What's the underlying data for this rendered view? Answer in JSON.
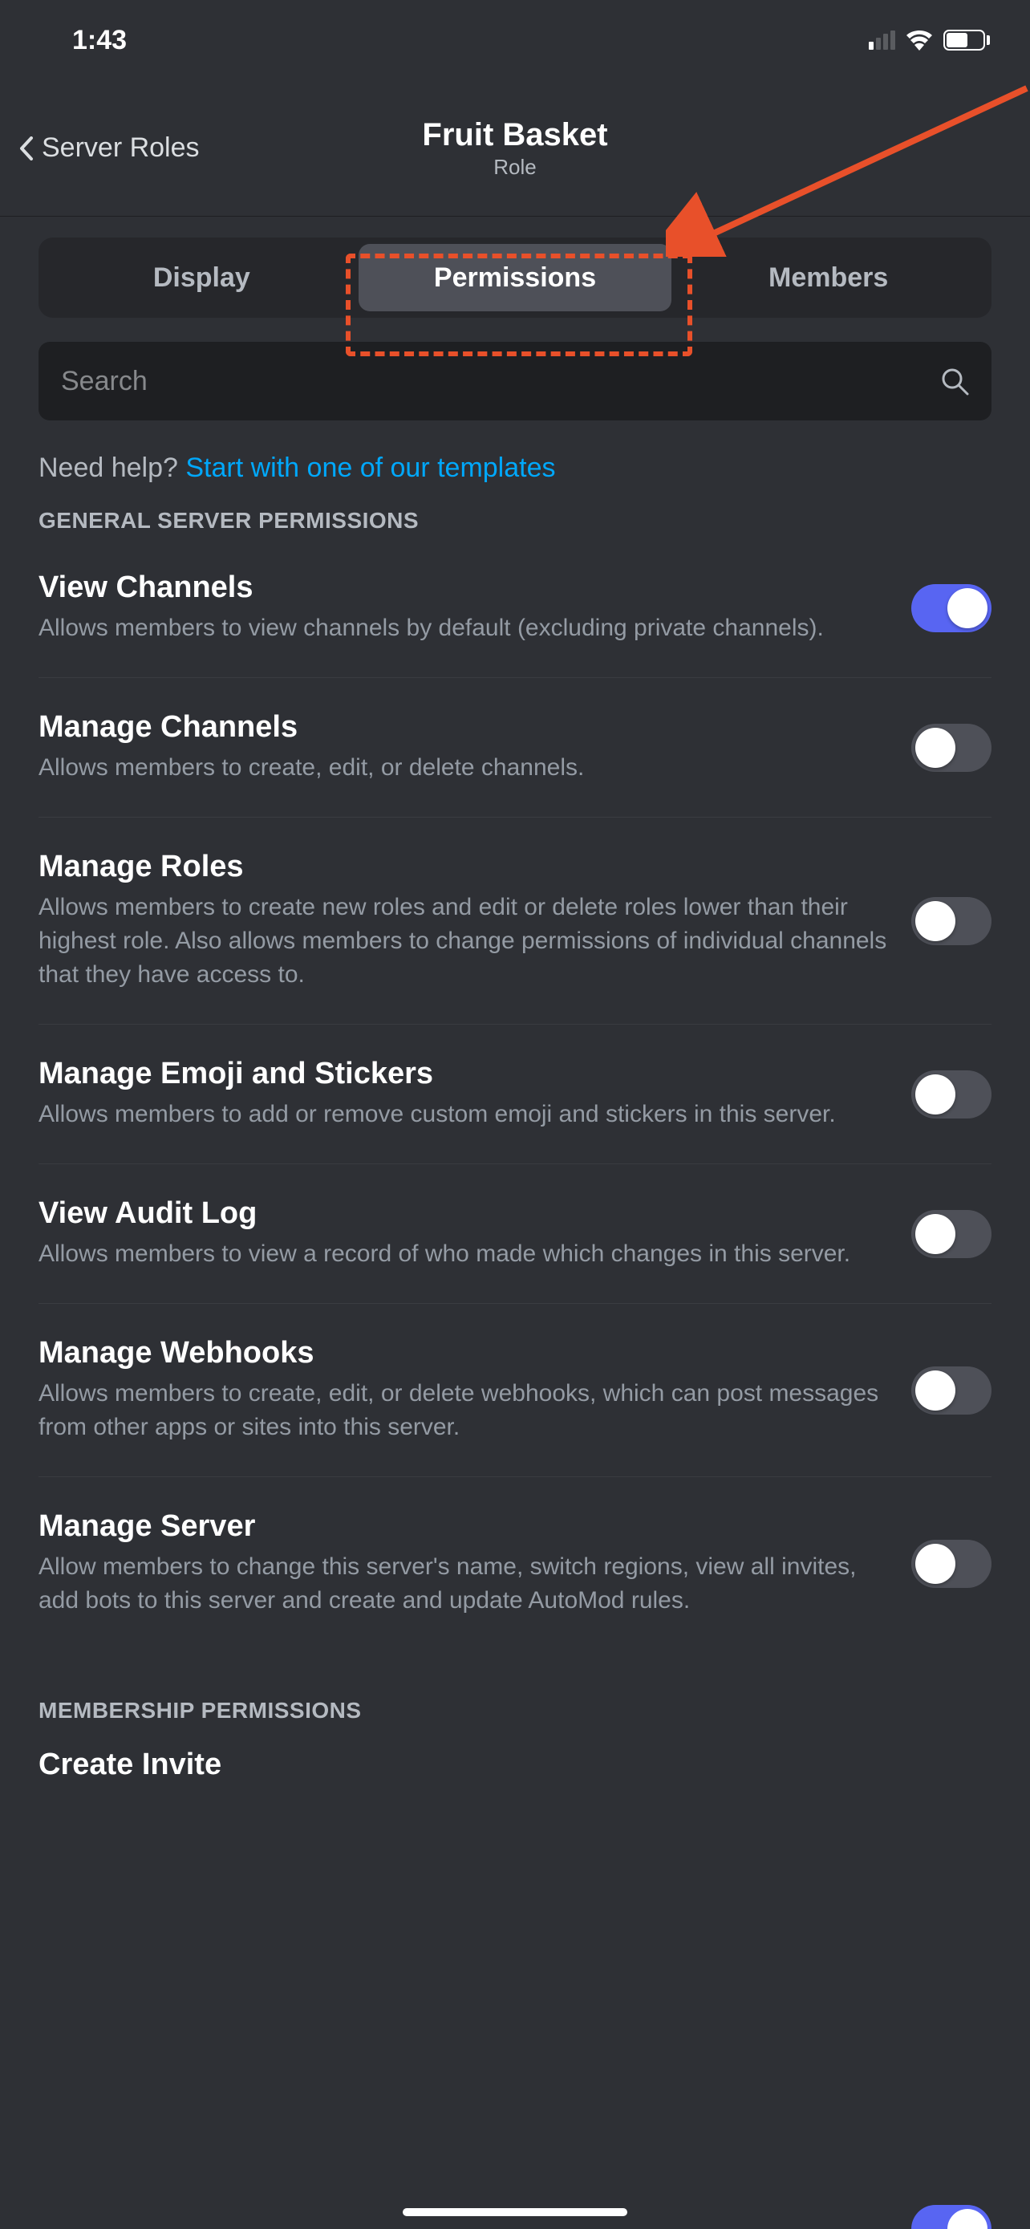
{
  "status": {
    "time": "1:43"
  },
  "header": {
    "back_label": "Server Roles",
    "title": "Fruit Basket",
    "subtitle": "Role"
  },
  "tabs": {
    "display": "Display",
    "permissions": "Permissions",
    "members": "Members",
    "active": "permissions"
  },
  "search": {
    "placeholder": "Search"
  },
  "help": {
    "prefix": "Need help? ",
    "link": "Start with one of our templates"
  },
  "sections": {
    "general_header": "GENERAL SERVER PERMISSIONS",
    "membership_header": "MEMBERSHIP PERMISSIONS"
  },
  "permissions": [
    {
      "title": "View Channels",
      "desc": "Allows members to view channels by default (excluding private channels).",
      "on": true
    },
    {
      "title": "Manage Channels",
      "desc": "Allows members to create, edit, or delete channels.",
      "on": false
    },
    {
      "title": "Manage Roles",
      "desc": "Allows members to create new roles and edit or delete roles lower than their highest role. Also allows members to change permissions of individual channels that they have access to.",
      "on": false
    },
    {
      "title": "Manage Emoji and Stickers",
      "desc": "Allows members to add or remove custom emoji and stickers in this server.",
      "on": false
    },
    {
      "title": "View Audit Log",
      "desc": "Allows members to view a record of who made which changes in this server.",
      "on": false
    },
    {
      "title": "Manage Webhooks",
      "desc": "Allows members to create, edit, or delete webhooks, which can post messages from other apps or sites into this server.",
      "on": false
    },
    {
      "title": "Manage Server",
      "desc": "Allow members to change this server's name, switch regions, view all invites, add bots to this server and create and update AutoMod rules.",
      "on": false
    }
  ],
  "partial": {
    "title": "Create Invite"
  }
}
